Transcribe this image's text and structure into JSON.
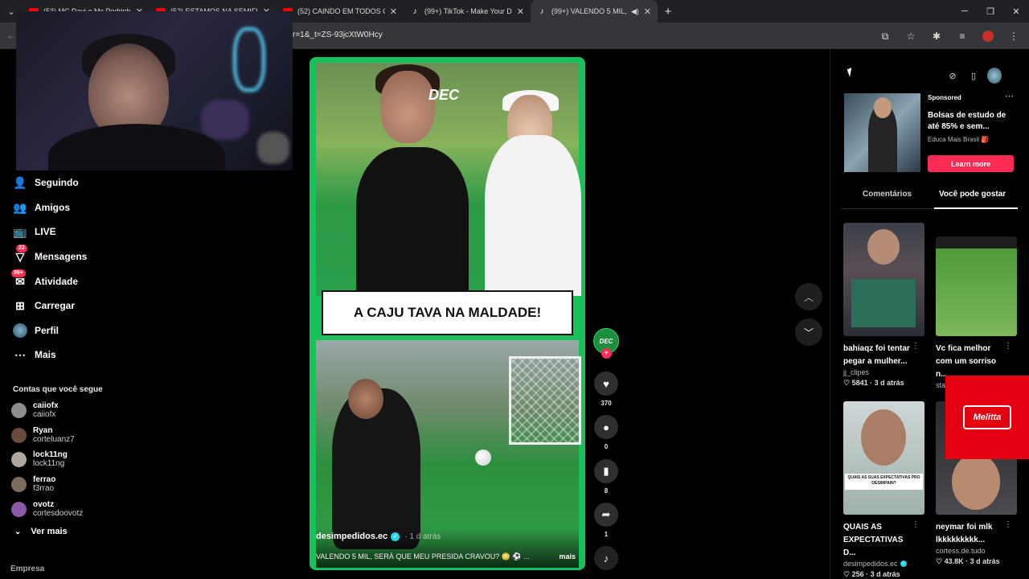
{
  "browser": {
    "tabs": [
      {
        "label": "(53) MC Davi e Mc Pedrinho - S",
        "favicon": "youtube-icon"
      },
      {
        "label": "(52) ESTAMOS NA SEMIFINAL!!",
        "favicon": "youtube-icon"
      },
      {
        "label": "(52) CAINDO EM TODOS OS G",
        "favicon": "youtube-icon"
      },
      {
        "label": "(99+) TikTok - Make Your Day",
        "favicon": "tiktok-icon"
      },
      {
        "label": "(99+) VALENDO 5 MIL, SERÁ",
        "favicon": "tiktok-icon",
        "active": true
      }
    ],
    "url": "r=1&_t=ZS-93jcXtW0Hcy"
  },
  "sidebar": {
    "items": [
      {
        "label": "Seguindo",
        "icon": "following-icon"
      },
      {
        "label": "Amigos",
        "icon": "friends-icon"
      },
      {
        "label": "LIVE",
        "icon": "live-icon"
      },
      {
        "label": "Mensagens",
        "icon": "messages-icon",
        "badge": "22"
      },
      {
        "label": "Atividade",
        "icon": "activity-icon",
        "badge": "99+"
      },
      {
        "label": "Carregar",
        "icon": "upload-icon"
      },
      {
        "label": "Perfil",
        "icon": "profile-icon"
      },
      {
        "label": "Mais",
        "icon": "more-icon"
      }
    ],
    "following_title": "Contas que você segue",
    "accounts": [
      {
        "name": "caiiofx",
        "handle": "caiiofx",
        "color": "#8d8d8d"
      },
      {
        "name": "Ryan",
        "handle": "corteluanz7",
        "color": "#6a4a3a"
      },
      {
        "name": "lock11ng",
        "handle": "lock11ng",
        "color": "#b0a8a0"
      },
      {
        "name": "ferrao",
        "handle": "f3rrao",
        "color": "#7c6c60"
      },
      {
        "name": "ovotz",
        "handle": "cortesdoovotz",
        "color": "#8a5aa8"
      }
    ],
    "see_more": "Ver mais",
    "footer": "Empresa"
  },
  "video": {
    "caption": "A CAJU TAVA NA MALDADE!",
    "overlay_logo": "DEC",
    "author": "desimpedidos.ec",
    "time": "· 1 d atrás",
    "description": "VALENDO 5 MIL, SERÁ QUE MEU PRESIDA CRAVOU? 😳 ⚽ ...",
    "more": "mais",
    "likes": "370",
    "comments": "0",
    "saves": "8",
    "shares": "1",
    "creator_badge": "DEC"
  },
  "panel": {
    "ad": {
      "sponsored": "Sponsored",
      "title": "Bolsas de estudo de até 85% e sem...",
      "brand": "Educa Mais Brasil 🎒",
      "cta": "Learn more"
    },
    "tabs": [
      "Comentários",
      "Você pode gostar"
    ],
    "cards": [
      {
        "title": "bahiaqz foi tentar pegar a mulher...",
        "author": "jj_clipes",
        "likes": "5841",
        "time": "3 d atrás"
      },
      {
        "title": "Vc fica melhor com um sorriso n...",
        "author": "stanley777z",
        "likes": "",
        "time": ""
      },
      {
        "title": "QUAIS AS EXPECTATIVAS D...",
        "author": "desimpedidos.ec",
        "likes": "256",
        "time": "3 d atrás",
        "thumb_text": "QUAIS AS SUAS EXPECTATIVAS PRO DESIMPAIN?"
      },
      {
        "title": "neymar foi mlk lkkkkkkkkk...",
        "author": "cortess.de.tudo",
        "likes": "43.8K",
        "time": "3 d atrás"
      }
    ],
    "overlay_brand": "Melitta"
  },
  "colors": {
    "accent": "#fe2c55",
    "video_frame": "#19c15a",
    "verified": "#20d5ec"
  }
}
